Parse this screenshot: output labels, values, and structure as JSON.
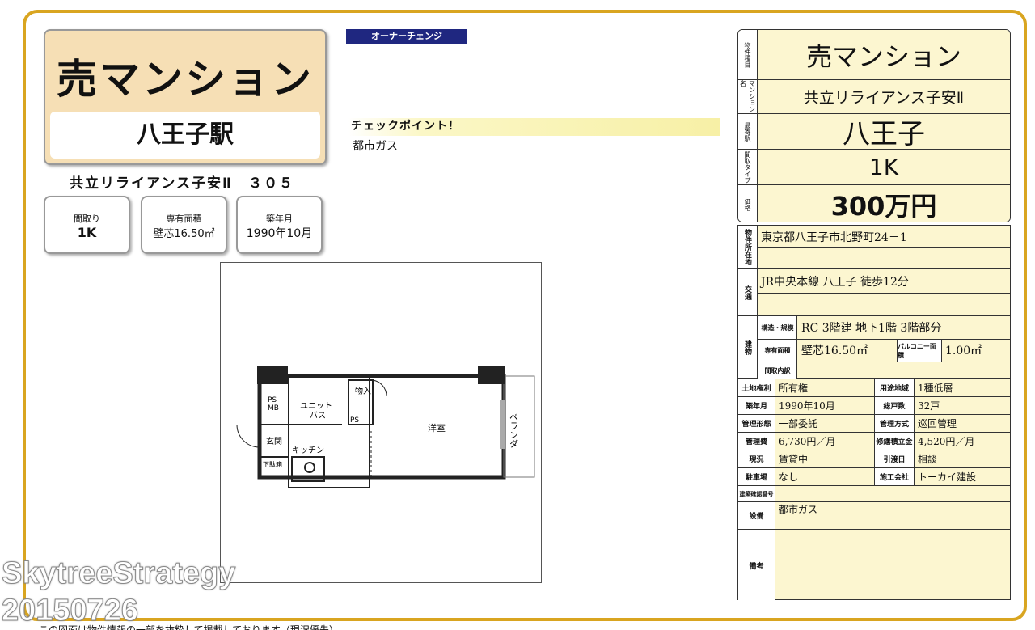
{
  "left": {
    "title": "売マンション",
    "station": "八王子駅",
    "building_room": "共立リライアンス子安Ⅱ　３０５",
    "madori_label": "間取り",
    "madori_value": "1K",
    "area_label": "専有面積",
    "area_value": "壁芯16.50㎡",
    "built_label": "築年月",
    "built_value": "1990年10月"
  },
  "owner_change": "オーナーチェンジ",
  "checkpoint": {
    "title": "チェックポイント！",
    "item": "都市ガス"
  },
  "floorplan": {
    "labels": [
      "PS MB",
      "ユニットバス",
      "物入",
      "PS",
      "洋室",
      "ベランダ",
      "玄関",
      "キッチン",
      "下駄箱"
    ]
  },
  "watermark": {
    "line1": "SkytreeStrategy",
    "line2": "20150726"
  },
  "footer_note": "この図面は物件情報の一部を抜粋して掲載しております（現況優先）",
  "summary": [
    {
      "label": "物件種目",
      "value": "売マンション"
    },
    {
      "label": "マンション名",
      "value": "共立リライアンス子安Ⅱ"
    },
    {
      "label": "最寄駅",
      "value": "八王子"
    },
    {
      "label": "間取タイプ",
      "value": "1K"
    },
    {
      "label": "価格",
      "value": "300万円"
    }
  ],
  "details": {
    "address_label": "物件所在地",
    "address": "東京都八王子市北野町24－1",
    "transport_label": "交通",
    "transport": "JR中央本線 八王子 徒歩12分",
    "bldg_label": "建物",
    "struct_label": "構造・規模",
    "struct": "RC 3階建 地下1階 3階部分",
    "area_label": "専有面積",
    "area_sub": "(壁芯面積)",
    "area": "壁芯16.50㎡",
    "balcony_label": "バルコニー面積",
    "balcony": "1.00㎡",
    "madori_label": "間取内訳",
    "grid": [
      [
        "土地権利",
        "所有権",
        "用途地域",
        "1種低層"
      ],
      [
        "築年月",
        "1990年10月",
        "総戸数",
        "32戸"
      ],
      [
        "管理形態",
        "一部委託",
        "管理方式",
        "巡回管理"
      ],
      [
        "管理費",
        "6,730円／月",
        "修繕積立金",
        "4,520円／月"
      ],
      [
        "現況",
        "賃貸中",
        "引渡日",
        "相談"
      ],
      [
        "駐車場",
        "なし",
        "施工会社",
        "トーカイ建設"
      ]
    ],
    "confirm_label": "建築確認番号",
    "equip_label": "設備",
    "equip": "都市ガス",
    "remarks_label": "備考"
  }
}
